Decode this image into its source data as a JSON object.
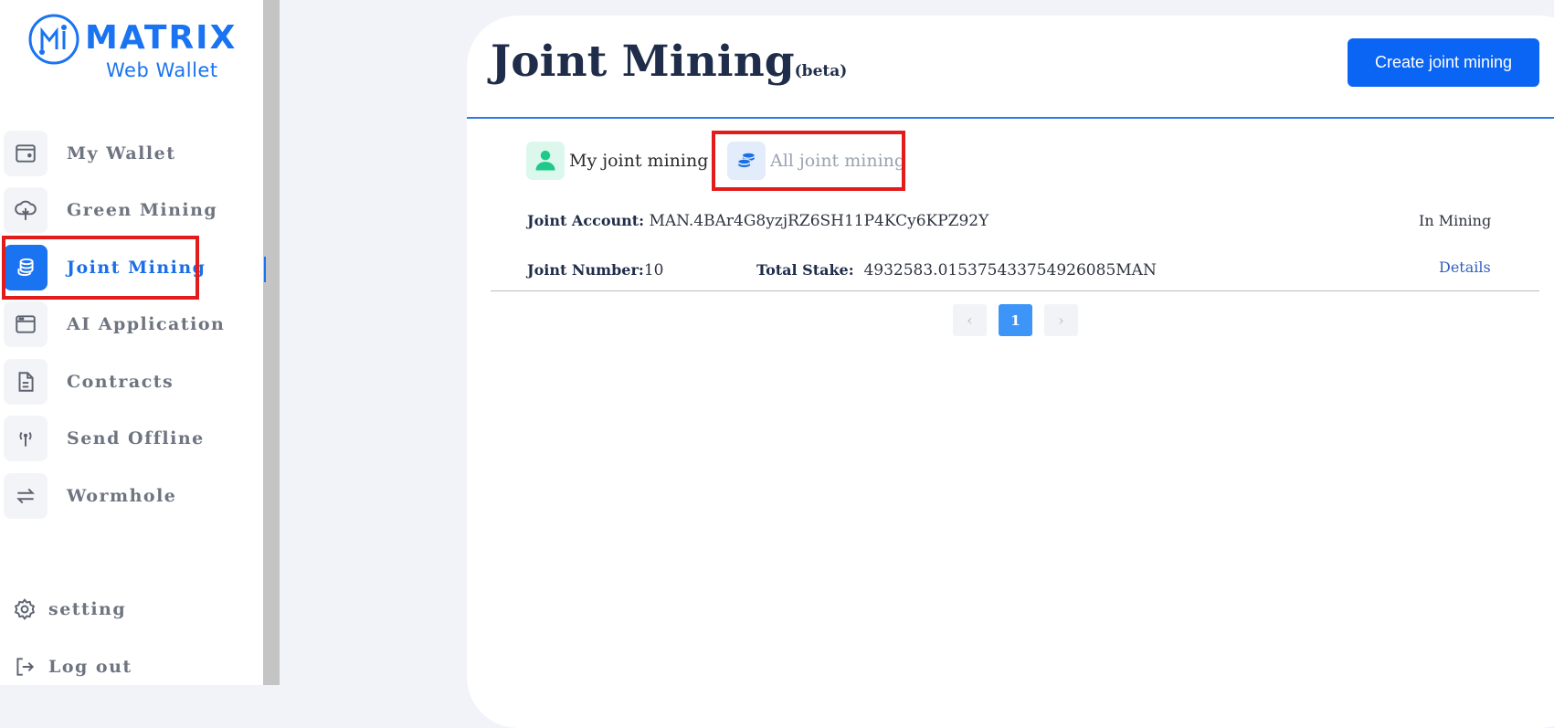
{
  "brand": {
    "name": "MATRIX",
    "subtitle": "Web Wallet",
    "color": "#1a73f0"
  },
  "sidebar": {
    "items": [
      {
        "label": "My Wallet",
        "icon": "wallet-icon"
      },
      {
        "label": "Green Mining",
        "icon": "tree-icon"
      },
      {
        "label": "Joint Mining",
        "icon": "coins-icon",
        "active": true
      },
      {
        "label": "AI Application",
        "icon": "browser-window-icon"
      },
      {
        "label": "Contracts",
        "icon": "document-icon"
      },
      {
        "label": "Send Offline",
        "icon": "antenna-icon"
      },
      {
        "label": "Wormhole",
        "icon": "swap-arrows-icon"
      }
    ],
    "setting_label": "setting",
    "logout_label": "Log out"
  },
  "header": {
    "title": "Joint Mining",
    "title_suffix": "(beta)",
    "create_button_label": "Create joint mining"
  },
  "tabs": [
    {
      "label": "My joint mining",
      "icon": "user-icon"
    },
    {
      "label": "All joint mining",
      "icon": "coins-icon",
      "selected": true
    }
  ],
  "mining_entry": {
    "account_label": "Joint Account:",
    "account_value": "MAN.4BAr4G8yzjRZ6SH11P4KCy6KPZ92Y",
    "status": "In Mining",
    "number_label": "Joint Number:",
    "number_value": "10",
    "stake_label": "Total Stake:",
    "stake_value": "4932583.015375433754926085MAN",
    "details_label": "Details"
  },
  "pagination": {
    "prev": "‹",
    "current_page": "1",
    "next": "›"
  },
  "colors": {
    "accent": "#1a73f0",
    "primary_button": "#0a64f4",
    "highlight_box": "#e21b1b",
    "page_active": "#3d95f7"
  }
}
